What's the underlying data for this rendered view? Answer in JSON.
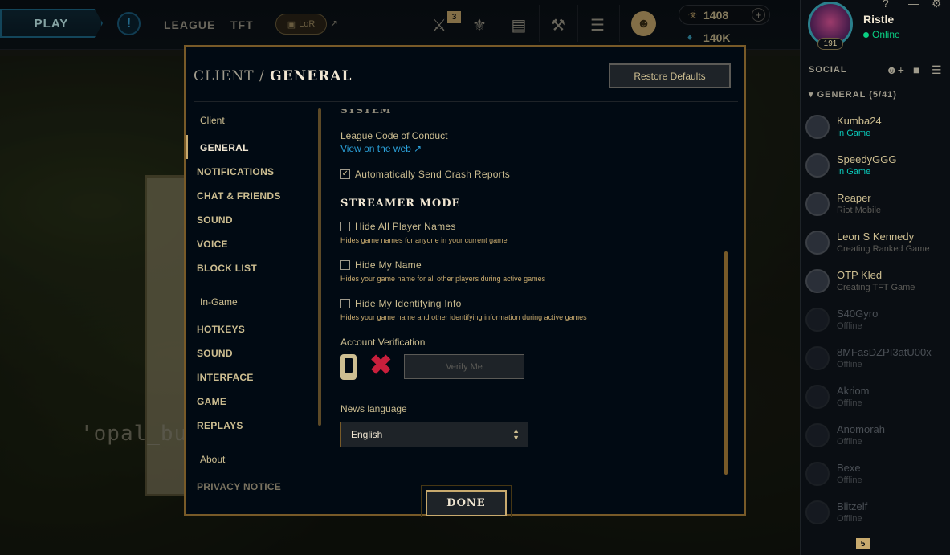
{
  "topnav": {
    "play_label": "PLAY",
    "alert_icon": "alert-icon",
    "league_label": "LEAGUE",
    "tft_label": "TFT",
    "lor_label": "LoR",
    "store_badge": "3",
    "rp_value": "1408",
    "be_value": "140K"
  },
  "profile": {
    "name": "Ristle",
    "status": "Online",
    "level": "191"
  },
  "social": {
    "title": "SOCIAL",
    "group": "GENERAL (5/41)",
    "bottom_badge": "5",
    "friends": [
      {
        "name": "Kumba24",
        "status": "In Game",
        "state": "online",
        "color": "#0ac8b9"
      },
      {
        "name": "SpeedyGGG",
        "status": "In Game",
        "state": "online",
        "color": "#0ac8b9"
      },
      {
        "name": "Reaper",
        "status": "Riot Mobile",
        "state": "mobile",
        "color": "#5b5a56"
      },
      {
        "name": "Leon S Kennedy",
        "status": "Creating Ranked Game",
        "state": "online",
        "color": "#5b5a56"
      },
      {
        "name": "OTP Kled",
        "status": "Creating TFT Game",
        "state": "online",
        "color": "#5b5a56"
      },
      {
        "name": "S40Gyro",
        "status": "Offline",
        "state": "offline",
        "color": "#3f4347"
      },
      {
        "name": "8MFasDZPI3atU00x",
        "status": "Offline",
        "state": "offline",
        "color": "#3f4347"
      },
      {
        "name": "Akriom",
        "status": "Offline",
        "state": "offline",
        "color": "#3f4347"
      },
      {
        "name": "Anomorah",
        "status": "Offline",
        "state": "offline",
        "color": "#3f4347"
      },
      {
        "name": "Bexe",
        "status": "Offline",
        "state": "offline",
        "color": "#3f4347"
      },
      {
        "name": "Blitzelf",
        "status": "Offline",
        "state": "offline",
        "color": "#3f4347"
      }
    ]
  },
  "background": {
    "watermark": "'opal_butto"
  },
  "modal": {
    "title_prefix": "CLIENT / ",
    "title_main": "GENERAL",
    "restore_label": "Restore Defaults",
    "nav": {
      "client_group": "Client",
      "general": "GENERAL",
      "notifications": "NOTIFICATIONS",
      "chat_friends": "CHAT & FRIENDS",
      "sound": "SOUND",
      "voice": "VOICE",
      "block_list": "BLOCK LIST",
      "ingame_group": "In-Game",
      "hotkeys": "HOTKEYS",
      "sound2": "SOUND",
      "interface": "INTERFACE",
      "game": "GAME",
      "replays": "REPLAYS",
      "about_group": "About",
      "privacy": "PRIVACY NOTICE"
    },
    "content": {
      "system_header": "SYSTEM",
      "coc_label": "League Code of Conduct",
      "coc_link": "View on the web ↗",
      "crash_reports": "Automatically Send Crash Reports",
      "crash_checked": true,
      "streamer_title": "STREAMER MODE",
      "hide_names": "Hide All Player Names",
      "hide_names_hint": "Hides game names for anyone in your current game",
      "hide_my_name": "Hide My Name",
      "hide_my_name_hint": "Hides your game name for all other players during active games",
      "hide_identifying": "Hide My Identifying Info",
      "hide_identifying_hint": "Hides your game name and other identifying information during active games",
      "account_verification": "Account Verification",
      "verify_label": "Verify Me",
      "news_language_label": "News language",
      "news_language_value": "English"
    },
    "done_label": "DONE"
  }
}
